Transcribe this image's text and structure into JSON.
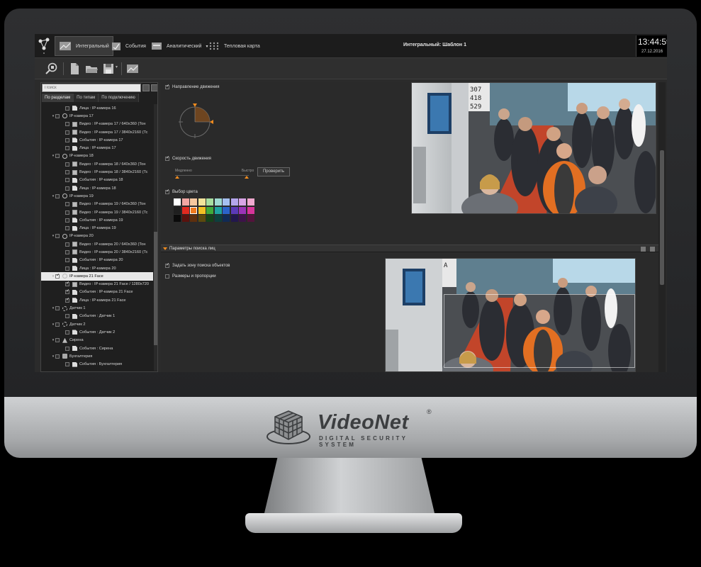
{
  "brand": {
    "name": "VideoNet",
    "registered": "®",
    "tagline": "DIGITAL SECURITY SYSTEM"
  },
  "topbar": {
    "tabs": [
      {
        "label": "Интегральный",
        "icon": "integral-view-icon",
        "active": true
      },
      {
        "label": "События",
        "icon": "events-icon",
        "active": false
      },
      {
        "label": "Аналитический",
        "icon": "analytics-icon",
        "active": false,
        "has_dropdown": true
      },
      {
        "label": "Тепловая карта",
        "icon": "heatmap-icon",
        "active": false
      }
    ],
    "window_title": "Интегральный: Шаблон 1",
    "clock_time": "13:44:59",
    "clock_date": "27.12.2016"
  },
  "toolbar": {
    "buttons": [
      "zoom-search-icon",
      "document-icon",
      "folder-open-icon",
      "save-icon",
      "layout-icon"
    ]
  },
  "tree": {
    "search_placeholder": "Поиск",
    "tabs": [
      {
        "label": "По разделам",
        "active": true
      },
      {
        "label": "По типам",
        "active": false
      },
      {
        "label": "По подключению",
        "active": false
      }
    ],
    "rows": [
      {
        "level": 2,
        "type": "doc",
        "label": "Лица : IP-камера 16",
        "checked": false,
        "expanded": null
      },
      {
        "level": 1,
        "type": "cam",
        "label": "IP-камера 17",
        "checked": false,
        "expanded": true
      },
      {
        "level": 2,
        "type": "vid",
        "label": "Видео : IP-камера 17 / 640x360 (Тон",
        "checked": false,
        "expanded": null
      },
      {
        "level": 2,
        "type": "vid",
        "label": "Видео : IP-камера 17 / 3840x2160 (Тс",
        "checked": false,
        "expanded": null
      },
      {
        "level": 2,
        "type": "doc",
        "label": "События : IP-камера 17",
        "checked": false,
        "expanded": null
      },
      {
        "level": 2,
        "type": "doc",
        "label": "Лица : IP-камера 17",
        "checked": false,
        "expanded": null
      },
      {
        "level": 1,
        "type": "cam",
        "label": "IP-камера 18",
        "checked": false,
        "expanded": true
      },
      {
        "level": 2,
        "type": "vid",
        "label": "Видео : IP-камера 18 / 640x360 (Тон",
        "checked": false,
        "expanded": null
      },
      {
        "level": 2,
        "type": "vid",
        "label": "Видео : IP-камера 18 / 3840x2160 (Тс",
        "checked": false,
        "expanded": null
      },
      {
        "level": 2,
        "type": "doc",
        "label": "События : IP-камера 18",
        "checked": false,
        "expanded": null
      },
      {
        "level": 2,
        "type": "doc",
        "label": "Лица : IP-камера 18",
        "checked": false,
        "expanded": null
      },
      {
        "level": 1,
        "type": "cam",
        "label": "IP-камера 19",
        "checked": false,
        "expanded": true
      },
      {
        "level": 2,
        "type": "vid",
        "label": "Видео : IP-камера 19 / 640x360 (Тон",
        "checked": false,
        "expanded": null
      },
      {
        "level": 2,
        "type": "vid",
        "label": "Видео : IP-камера 19 / 3840x2160 (Тс",
        "checked": false,
        "expanded": null
      },
      {
        "level": 2,
        "type": "doc",
        "label": "События : IP-камера 19",
        "checked": false,
        "expanded": null
      },
      {
        "level": 2,
        "type": "doc",
        "label": "Лица : IP-камера 19",
        "checked": false,
        "expanded": null
      },
      {
        "level": 1,
        "type": "cam",
        "label": "IP-камера 20",
        "checked": false,
        "expanded": true
      },
      {
        "level": 2,
        "type": "vid",
        "label": "Видео : IP-камера 20 / 640x360 (Тон",
        "checked": false,
        "expanded": null
      },
      {
        "level": 2,
        "type": "vid",
        "label": "Видео : IP-камера 20 / 3840x2160 (Тс",
        "checked": false,
        "expanded": null
      },
      {
        "level": 2,
        "type": "doc",
        "label": "События : IP-камера 20",
        "checked": false,
        "expanded": null
      },
      {
        "level": 2,
        "type": "doc",
        "label": "Лица : IP-камера 20",
        "checked": false,
        "expanded": null
      },
      {
        "level": 1,
        "type": "cam",
        "label": "IP-камера 21 Face",
        "checked": true,
        "expanded": true,
        "selected": true
      },
      {
        "level": 2,
        "type": "vid",
        "label": "Видео : IP-камера 21 Face / 1280x720",
        "checked": true,
        "expanded": null
      },
      {
        "level": 2,
        "type": "doc",
        "label": "События : IP-камера 21 Face",
        "checked": true,
        "expanded": null
      },
      {
        "level": 2,
        "type": "doc",
        "label": "Лица : IP-камера 21 Face",
        "checked": true,
        "expanded": null
      },
      {
        "level": 1,
        "type": "sens",
        "label": "Датчик 1",
        "checked": false,
        "expanded": true
      },
      {
        "level": 2,
        "type": "doc",
        "label": "События : Датчик 1",
        "checked": false,
        "expanded": null
      },
      {
        "level": 1,
        "type": "sens",
        "label": "Датчик 2",
        "checked": false,
        "expanded": true
      },
      {
        "level": 2,
        "type": "doc",
        "label": "События : Датчик 2",
        "checked": false,
        "expanded": null
      },
      {
        "level": 1,
        "type": "siren",
        "label": "Сирена",
        "checked": false,
        "expanded": true
      },
      {
        "level": 2,
        "type": "doc",
        "label": "События : Сирена",
        "checked": false,
        "expanded": null
      },
      {
        "level": 1,
        "type": "acct",
        "label": "Бухгалтерия",
        "checked": false,
        "expanded": true
      },
      {
        "level": 2,
        "type": "doc",
        "label": "События : Бухгалтерия",
        "checked": false,
        "expanded": null
      }
    ]
  },
  "filters": {
    "direction": {
      "label": "Направление движения",
      "checked": true
    },
    "speed": {
      "label": "Скорость движения",
      "checked": true,
      "min_label": "Медленно",
      "max_label": "Быстро",
      "check_button": "Проверить"
    },
    "color": {
      "label": "Выбор цвета",
      "checked": true,
      "swatches": [
        "#ffffff",
        "#f2a7a3",
        "#f5c8a0",
        "#f2e39a",
        "#a8dea0",
        "#9fd9d1",
        "#a5bff0",
        "#b4a6ec",
        "#d8a4e6",
        "#f0a9cf",
        "#1f1f1f",
        "#e02a20",
        "#f07a1e",
        "#f0c024",
        "#3faa3a",
        "#1fa3a0",
        "#2b63c9",
        "#5b3ab8",
        "#9b33b7",
        "#d7349a",
        "#0b0b0b",
        "#5a120e",
        "#5e2f0e",
        "#5c4a0e",
        "#14431a",
        "#0e3f3d",
        "#112a55",
        "#22174d",
        "#3d1349",
        "#54133c"
      ],
      "selected_index": 12
    }
  },
  "face_section": {
    "title": "Параметры поиска лиц",
    "options": [
      {
        "label": "Задать зону поиска объектов",
        "checked": true
      },
      {
        "label": "Размеры и пропорции",
        "checked": false
      }
    ]
  },
  "colors": {
    "accent": "#ef8b1f",
    "screen_bg": "#2b2b2b"
  }
}
